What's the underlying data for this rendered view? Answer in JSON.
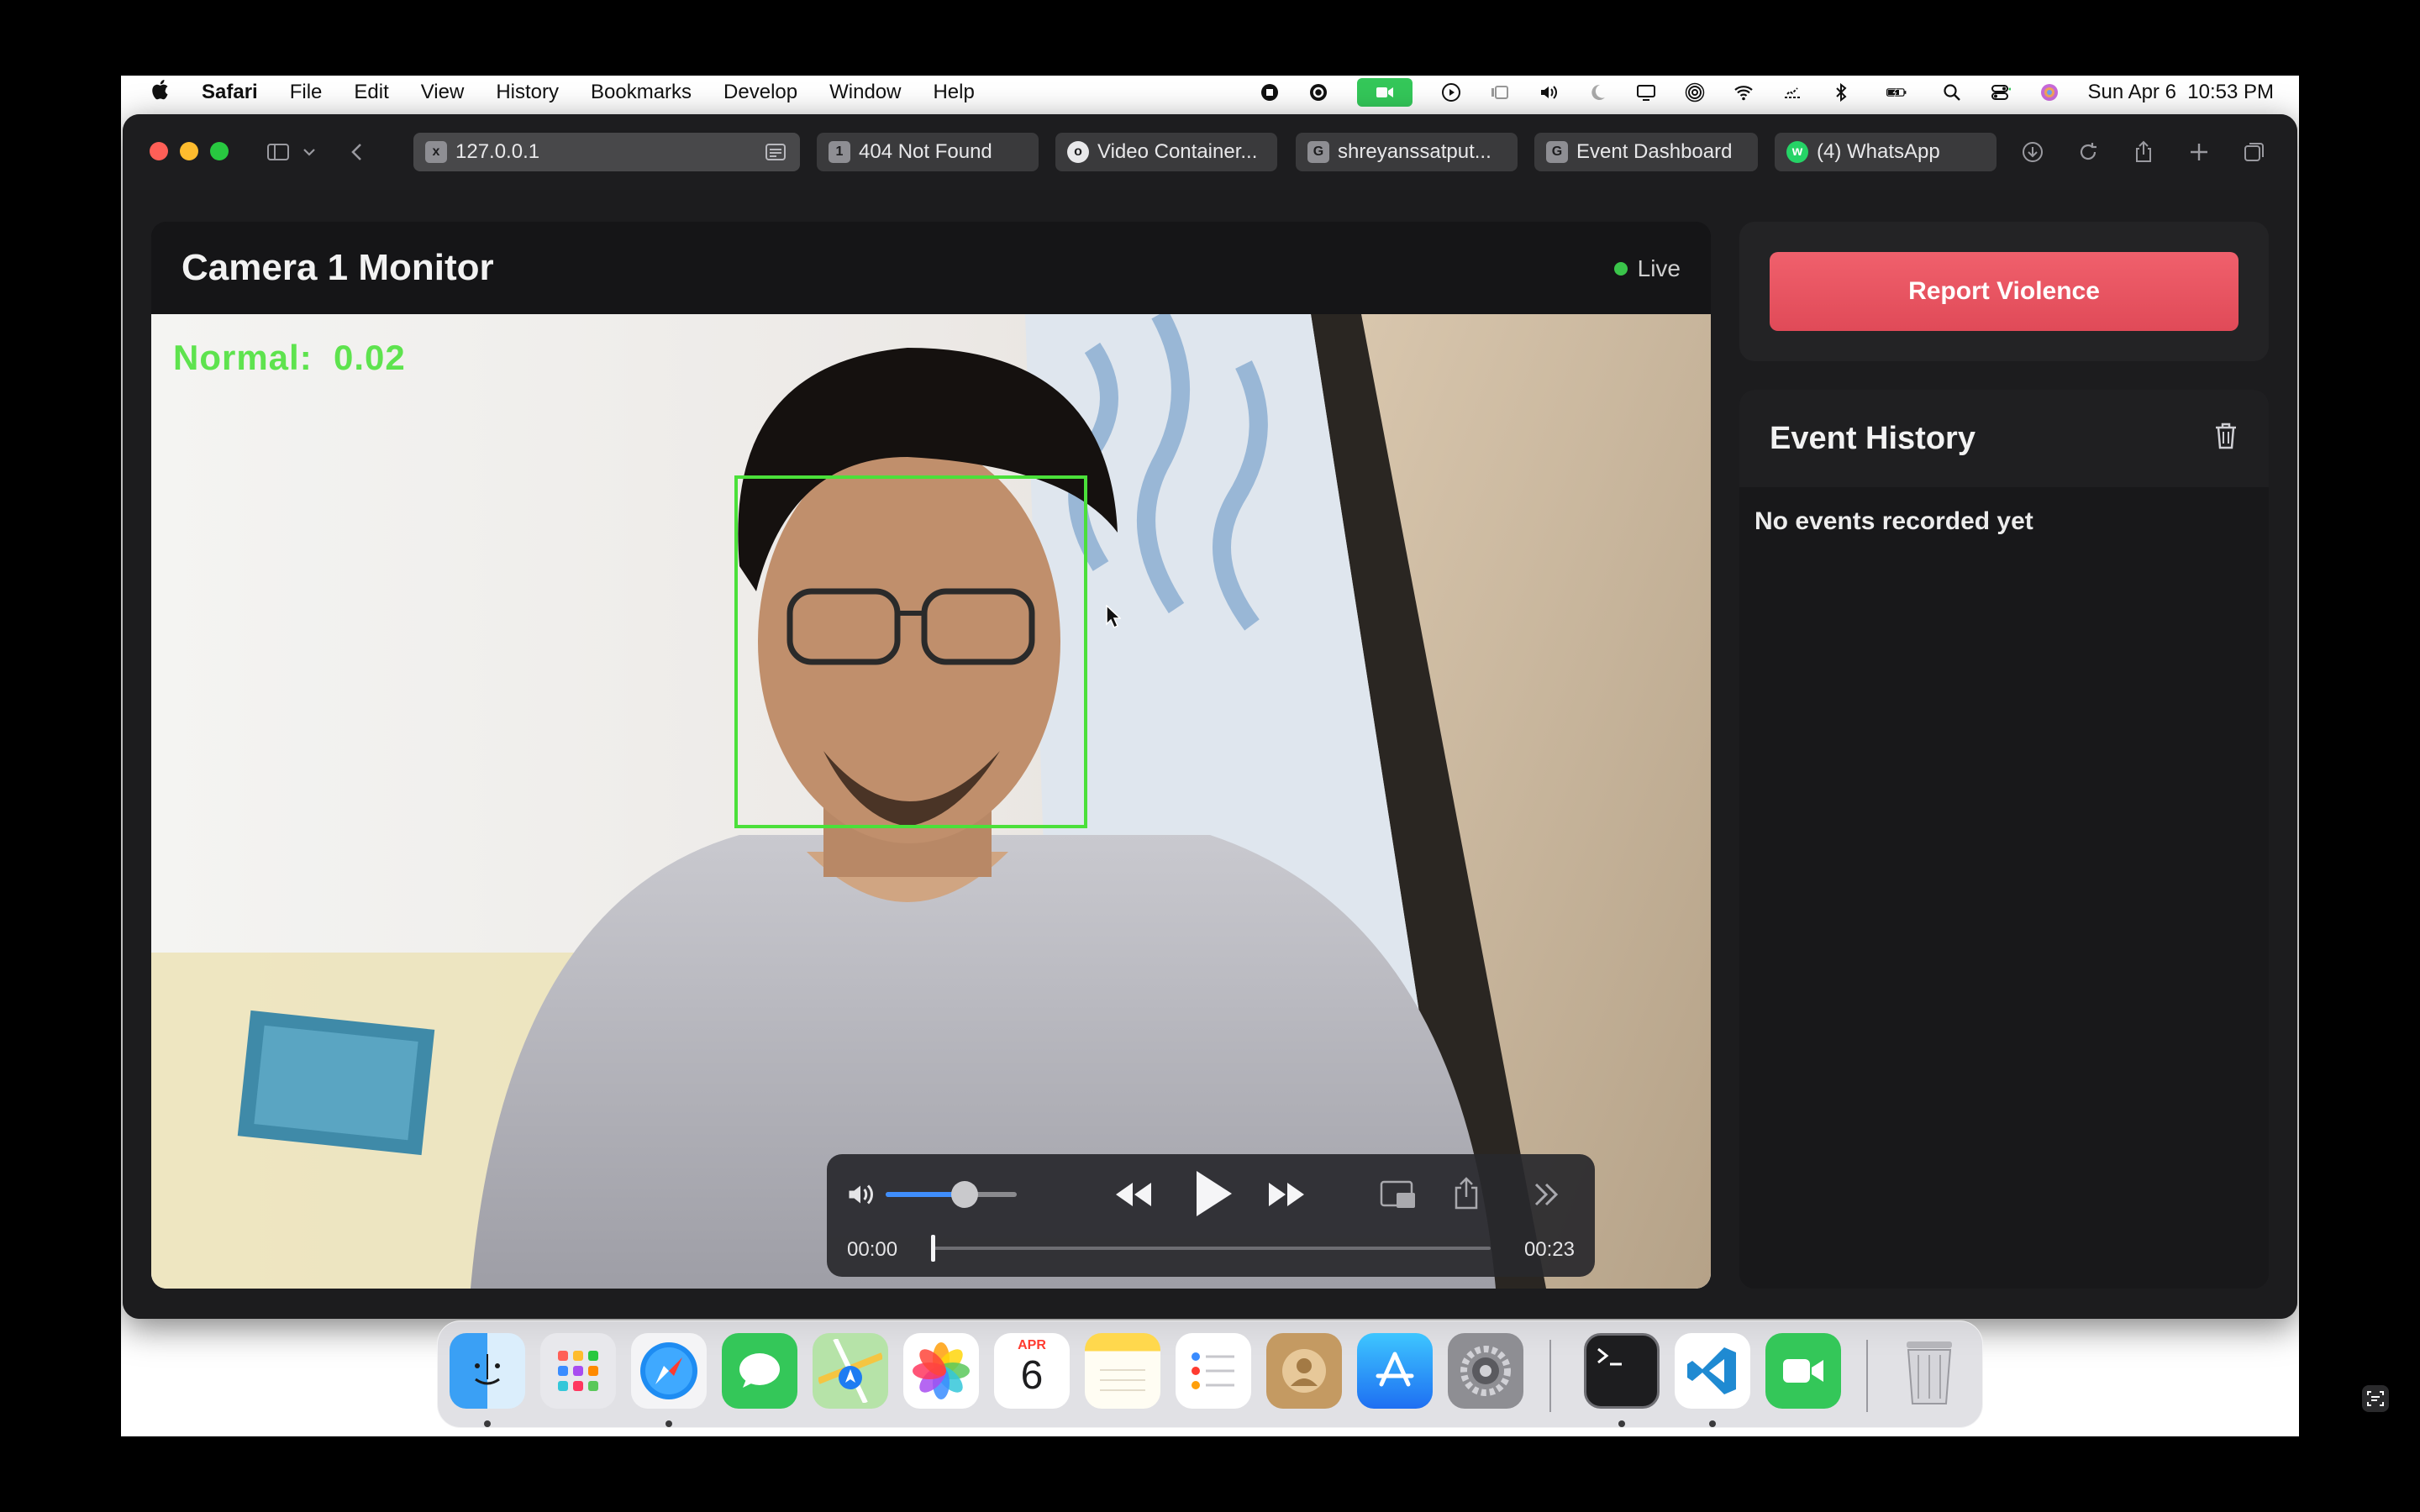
{
  "menubar": {
    "apple": "",
    "app": "Safari",
    "items": [
      "File",
      "Edit",
      "View",
      "History",
      "Bookmarks",
      "Develop",
      "Window",
      "Help"
    ],
    "clock": "Sun Apr 6  10:53 PM"
  },
  "tabs": [
    {
      "label": "127.0.0.1",
      "favicon": "x"
    },
    {
      "label": "404 Not Found",
      "favicon": "1"
    },
    {
      "label": "Video Container...",
      "favicon": "o"
    },
    {
      "label": "shreyanssatput...",
      "favicon": "G"
    },
    {
      "label": "Event Dashboard",
      "favicon": "G"
    },
    {
      "label": "(4) WhatsApp",
      "favicon": "w"
    }
  ],
  "camera": {
    "title": "Camera 1 Monitor",
    "status": "Live",
    "overlay": "Normal:  0.02"
  },
  "player": {
    "current_time": "00:00",
    "duration": "00:23",
    "volume_level": 0.6,
    "progress": 0.0
  },
  "report": {
    "label": "Report Violence"
  },
  "history": {
    "title": "Event History",
    "empty": "No events recorded yet"
  },
  "dock": {
    "calendar_month": "APR",
    "calendar_day": "6"
  },
  "colors": {
    "accent_red": "#e8525f",
    "live_green": "#3ac44a",
    "detect_green": "#4be03a"
  }
}
